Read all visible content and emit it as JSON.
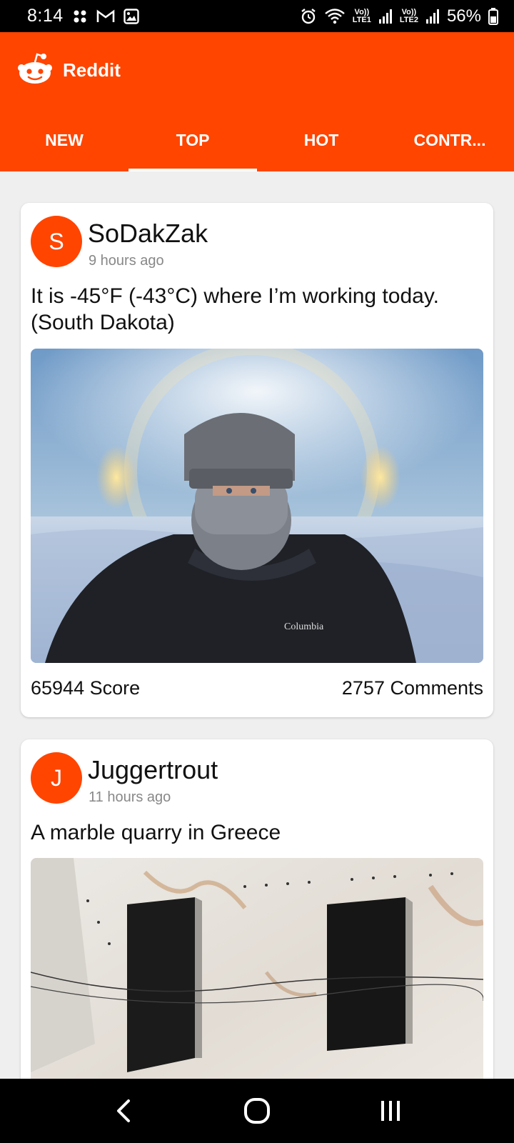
{
  "status_bar": {
    "time": "8:14",
    "net1_top": "Vo))",
    "net1_bottom": "LTE1",
    "net2_top": "Vo))",
    "net2_bottom": "LTE2",
    "battery": "56%",
    "icons": [
      "notification-dots-icon",
      "gmail-icon",
      "gallery-icon",
      "alarm-icon",
      "wifi-icon",
      "signal-icon",
      "battery-icon"
    ]
  },
  "app": {
    "title": "Reddit",
    "brand_color": "#ff4500",
    "logo_icon": "reddit-alien-icon"
  },
  "tabs": [
    {
      "label": "NEW",
      "active": false
    },
    {
      "label": "TOP",
      "active": true
    },
    {
      "label": "HOT",
      "active": false
    },
    {
      "label": "CONTR...",
      "active": false
    }
  ],
  "posts": [
    {
      "avatar_letter": "S",
      "author": "SoDakZak",
      "time": "9 hours ago",
      "title": "It is -45°F (-43°C) where I’m working today. (South Dakota)",
      "score": "65944 Score",
      "comments": "2757 Comments"
    },
    {
      "avatar_letter": "J",
      "author": "Juggertrout",
      "time": "11 hours ago",
      "title": "A marble quarry in Greece"
    }
  ],
  "navigation": [
    "back-icon",
    "home-icon",
    "recents-icon"
  ]
}
